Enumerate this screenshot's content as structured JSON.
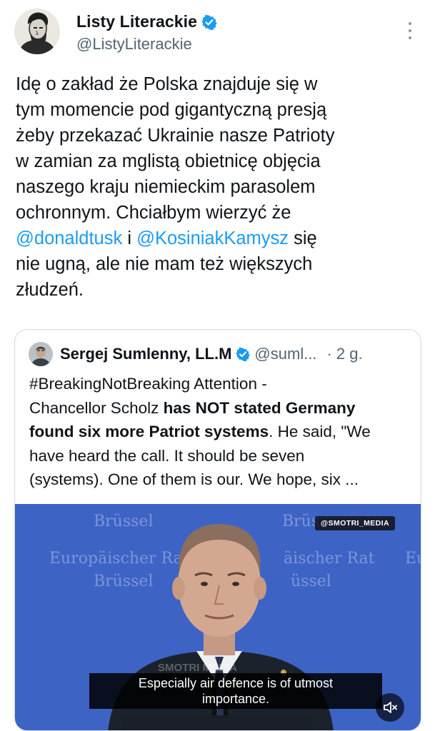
{
  "author": {
    "display_name": "Listy Literackie",
    "handle": "@ListyLiterackie",
    "avatar_icon": "portrait-avatar",
    "verified_icon": "verified-badge-icon"
  },
  "tweet": {
    "lines": {
      "l1": "Idę o zakład że Polska znajduje się w",
      "l2": "tym momencie pod gigantyczną presją",
      "l3": "żeby przekazać Ukrainie nasze Patrioty",
      "l4": "w zamian za mglistą obietnicę objęcia",
      "l5": "naszego kraju niemieckim parasolem",
      "l6": "ochronnym. Chciałbym wierzyć że",
      "l7_mention1": "@donaldtusk",
      "l7_mid": " i ",
      "l7_mention2": "@KosiniakKamysz",
      "l7_end": " się",
      "l8": "nie ugną, ale nie mam też większych",
      "l9": "złudzeń."
    }
  },
  "quote": {
    "display_name": "Sergej Sumlenny, LL.M",
    "handle": "@suml...",
    "separator": "·",
    "time": "2 g.",
    "lines": {
      "l1": "#BreakingNotBreaking Attention -",
      "l2_a": "Chancellor Scholz ",
      "l2_b": "has NOT stated Germany",
      "l3_b": "found six more Patriot systems",
      "l3_a": ". He said, \"We",
      "l4": "have heard the call. It should be seven",
      "l5": "(systems). One of them is our. We hope, six ..."
    },
    "media": {
      "bg_texts": {
        "t1": "Brüssel",
        "t2": "Brüss",
        "t3": "Europäischer Rat",
        "t4": "äischer Rat",
        "t5": "Eu",
        "t6": "Brüssel",
        "t7": "üssel",
        "t8": "SMOTRI MEDIA"
      },
      "watermark": "@SMOTRI_MEDIA",
      "subtitle_l1": "Especially air defence is of utmost",
      "subtitle_l2": "importance.",
      "mute_icon": "speaker-muted-icon"
    }
  },
  "colors": {
    "text": "#0f1419",
    "secondary": "#536471",
    "link": "#1d9bf0",
    "border": "#cfd9de",
    "media_bg": "#3d63c5"
  }
}
